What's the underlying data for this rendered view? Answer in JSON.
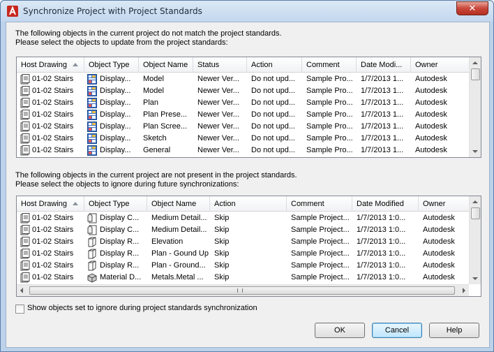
{
  "window": {
    "title": "Synchronize Project with Project Standards",
    "close_label": "✕"
  },
  "top_section": {
    "line1": "The following objects in the current project do not match the project standards.",
    "line2": "Please select the objects to update from the project standards:",
    "columns": [
      "Host Drawing",
      "Object Type",
      "Object Name",
      "Status",
      "Action",
      "Comment",
      "Date Modi...",
      "Owner"
    ],
    "rows": [
      {
        "host": "01-02 Stairs",
        "type": "Display...",
        "name": "Model",
        "status": "Newer Ver...",
        "action": "Do not upd...",
        "comment": "Sample Pro...",
        "date": "1/7/2013 1...",
        "owner": "Autodesk"
      },
      {
        "host": "01-02 Stairs",
        "type": "Display...",
        "name": "Model",
        "status": "Newer Ver...",
        "action": "Do not upd...",
        "comment": "Sample Pro...",
        "date": "1/7/2013 1...",
        "owner": "Autodesk"
      },
      {
        "host": "01-02 Stairs",
        "type": "Display...",
        "name": "Plan",
        "status": "Newer Ver...",
        "action": "Do not upd...",
        "comment": "Sample Pro...",
        "date": "1/7/2013 1...",
        "owner": "Autodesk"
      },
      {
        "host": "01-02 Stairs",
        "type": "Display...",
        "name": "Plan Prese...",
        "status": "Newer Ver...",
        "action": "Do not upd...",
        "comment": "Sample Pro...",
        "date": "1/7/2013 1...",
        "owner": "Autodesk"
      },
      {
        "host": "01-02 Stairs",
        "type": "Display...",
        "name": "Plan Scree...",
        "status": "Newer Ver...",
        "action": "Do not upd...",
        "comment": "Sample Pro...",
        "date": "1/7/2013 1...",
        "owner": "Autodesk"
      },
      {
        "host": "01-02 Stairs",
        "type": "Display...",
        "name": "Sketch",
        "status": "Newer Ver...",
        "action": "Do not upd...",
        "comment": "Sample Pro...",
        "date": "1/7/2013 1...",
        "owner": "Autodesk"
      },
      {
        "host": "01-02 Stairs",
        "type": "Display...",
        "name": "General",
        "status": "Newer Ver...",
        "action": "Do not upd...",
        "comment": "Sample Pro...",
        "date": "1/7/2013 1...",
        "owner": "Autodesk"
      }
    ]
  },
  "bottom_section": {
    "line1": "The following objects in the current project are not present in the project standards.",
    "line2": "Please select the objects to ignore during future synchronizations:",
    "columns": [
      "Host Drawing",
      "Object Type",
      "Object Name",
      "Action",
      "Comment",
      "Date Modified",
      "Owner"
    ],
    "rows": [
      {
        "host": "01-02 Stairs",
        "type": "Display C...",
        "name": "Medium Detail...",
        "action": "Skip",
        "comment": "Sample Project...",
        "date": "1/7/2013 1:0...",
        "owner": "Autodesk",
        "icon": "display-config-icon"
      },
      {
        "host": "01-02 Stairs",
        "type": "Display C...",
        "name": "Medium Detail...",
        "action": "Skip",
        "comment": "Sample Project...",
        "date": "1/7/2013 1:0...",
        "owner": "Autodesk",
        "icon": "display-config-icon"
      },
      {
        "host": "01-02 Stairs",
        "type": "Display R...",
        "name": "Elevation",
        "action": "Skip",
        "comment": "Sample Project...",
        "date": "1/7/2013 1:0...",
        "owner": "Autodesk",
        "icon": "display-rep-icon"
      },
      {
        "host": "01-02 Stairs",
        "type": "Display R...",
        "name": "Plan - Gound Up",
        "action": "Skip",
        "comment": "Sample Project...",
        "date": "1/7/2013 1:0...",
        "owner": "Autodesk",
        "icon": "display-rep-icon"
      },
      {
        "host": "01-02 Stairs",
        "type": "Display R...",
        "name": "Plan - Ground...",
        "action": "Skip",
        "comment": "Sample Project...",
        "date": "1/7/2013 1:0...",
        "owner": "Autodesk",
        "icon": "display-rep-icon"
      },
      {
        "host": "01-02 Stairs",
        "type": "Material D...",
        "name": "Metals.Metal ...",
        "action": "Skip",
        "comment": "Sample Project...",
        "date": "1/7/2013 1:0...",
        "owner": "Autodesk",
        "icon": "material-icon"
      }
    ]
  },
  "checkbox": {
    "label": "Show objects set to ignore during project standards synchronization",
    "checked": false
  },
  "buttons": {
    "ok": "OK",
    "cancel": "Cancel",
    "help": "Help"
  },
  "colors": {
    "accent": "#3c7fb1",
    "close_red": "#c9463a"
  }
}
